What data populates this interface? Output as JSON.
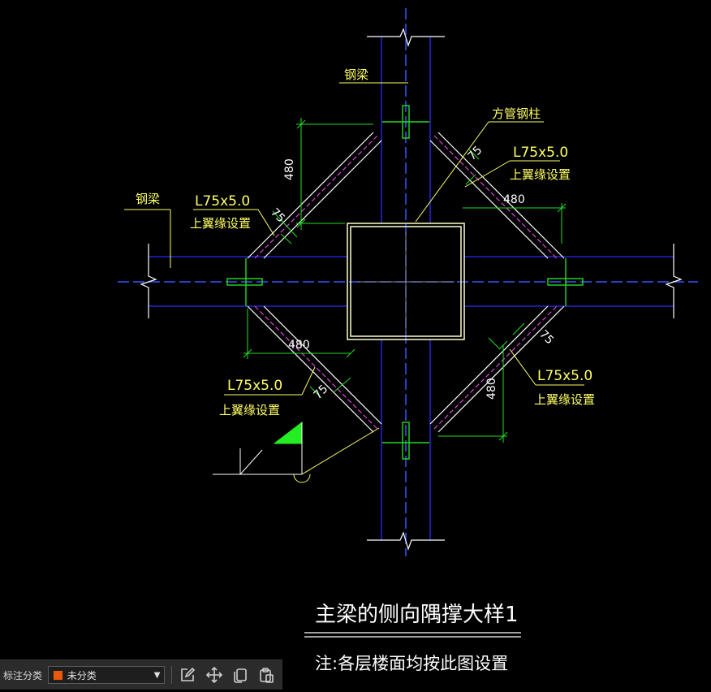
{
  "drawing": {
    "labels": {
      "steel_beam_top": "钢梁",
      "steel_beam_left": "钢梁",
      "column": "方管钢柱",
      "angle_tr": "L75x5.0",
      "flange_tr": "上翼缘设置",
      "angle_l": "L75x5.0",
      "flange_l": "上翼缘设置",
      "angle_bl": "L75x5.0",
      "flange_bl": "上翼缘设置",
      "angle_br": "L75x5.0",
      "flange_br": "上翼缘设置"
    },
    "dimensions": {
      "d_480_tl": "480",
      "d_480_tr": "480",
      "d_480_bl": "480",
      "d_480_br": "480",
      "d_75_tl": "75",
      "d_75_tr": "75",
      "d_75_bl": "75",
      "d_75_br": "75"
    },
    "title": "主梁的侧向隅撑大样1",
    "note": "注:各层楼面均按此图设置"
  },
  "toolbar": {
    "label": "标注分类",
    "selected": "未分类",
    "icons": [
      "edit-icon",
      "move-icon",
      "copy-icon",
      "paste-icon"
    ]
  },
  "colors": {
    "beam": "#1a1aff",
    "brace": "#ffffff",
    "dim": "#22dd22",
    "text": "#ffff66",
    "column": "#ffffcc",
    "toolbar_bg": "#2b2b2b",
    "swatch": "#e8590c"
  }
}
